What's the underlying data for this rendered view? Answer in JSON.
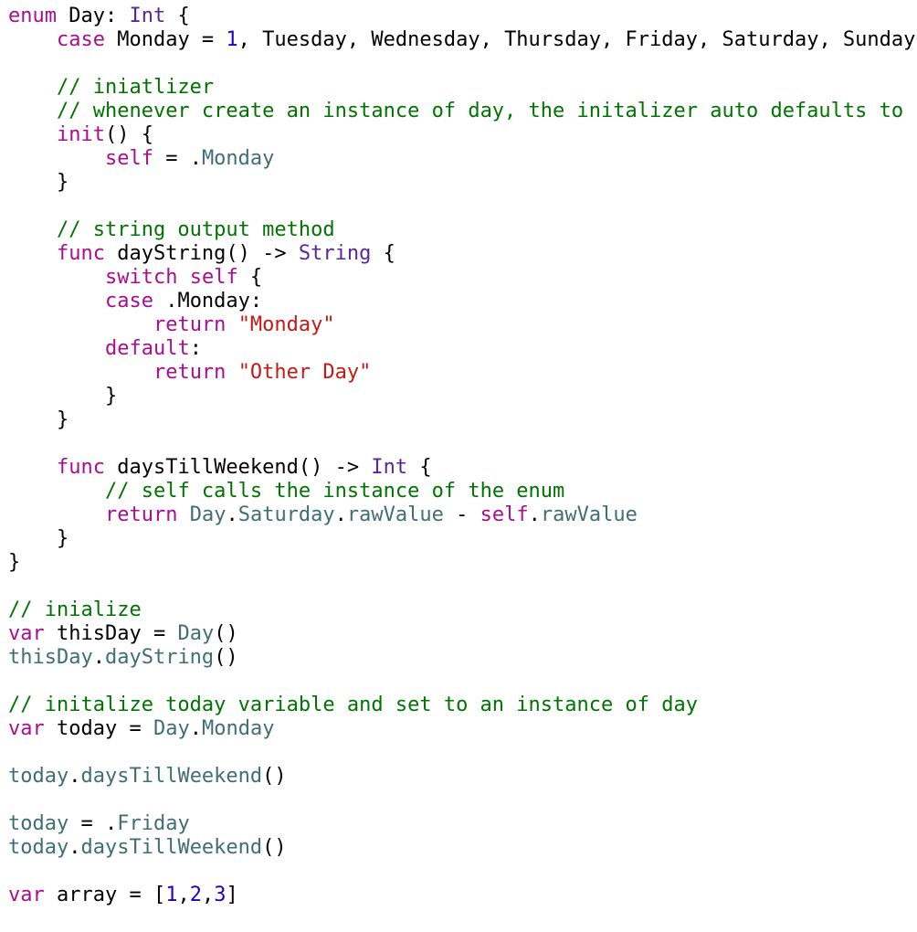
{
  "colors": {
    "keyword": "#aa0d91",
    "type": "#5c2699",
    "comment": "#007400",
    "string": "#c41a16",
    "number": "#1c00cf",
    "project": "#3f6e74",
    "plain": "#000000",
    "background": "#ffffff"
  },
  "lines": [
    [
      [
        "kw",
        "enum"
      ],
      [
        "pl",
        " Day: "
      ],
      [
        "ty",
        "Int"
      ],
      [
        "pl",
        " {"
      ]
    ],
    [
      [
        "pl",
        "    "
      ],
      [
        "kw",
        "case"
      ],
      [
        "pl",
        " Monday = "
      ],
      [
        "nm",
        "1"
      ],
      [
        "pl",
        ", Tuesday, Wednesday, Thursday, Friday, Saturday, Sunday"
      ]
    ],
    [],
    [
      [
        "pl",
        "    "
      ],
      [
        "cm",
        "// iniatlizer"
      ]
    ],
    [
      [
        "pl",
        "    "
      ],
      [
        "cm",
        "// whenever create an instance of day, the initalizer auto defaults to s"
      ]
    ],
    [
      [
        "pl",
        "    "
      ],
      [
        "kw",
        "init"
      ],
      [
        "pl",
        "() {"
      ]
    ],
    [
      [
        "pl",
        "        "
      ],
      [
        "kw",
        "self"
      ],
      [
        "pl",
        " = ."
      ],
      [
        "pj",
        "Monday"
      ]
    ],
    [
      [
        "pl",
        "    }"
      ]
    ],
    [],
    [
      [
        "pl",
        "    "
      ],
      [
        "cm",
        "// string output method"
      ]
    ],
    [
      [
        "pl",
        "    "
      ],
      [
        "kw",
        "func"
      ],
      [
        "pl",
        " dayString() -> "
      ],
      [
        "ty",
        "String"
      ],
      [
        "pl",
        " {"
      ]
    ],
    [
      [
        "pl",
        "        "
      ],
      [
        "kw",
        "switch"
      ],
      [
        "pl",
        " "
      ],
      [
        "kw",
        "self"
      ],
      [
        "pl",
        " {"
      ]
    ],
    [
      [
        "pl",
        "        "
      ],
      [
        "kw",
        "case"
      ],
      [
        "pl",
        " .Monday:"
      ]
    ],
    [
      [
        "pl",
        "            "
      ],
      [
        "kw",
        "return"
      ],
      [
        "pl",
        " "
      ],
      [
        "st",
        "\"Monday\""
      ]
    ],
    [
      [
        "pl",
        "        "
      ],
      [
        "kw",
        "default"
      ],
      [
        "pl",
        ":"
      ]
    ],
    [
      [
        "pl",
        "            "
      ],
      [
        "kw",
        "return"
      ],
      [
        "pl",
        " "
      ],
      [
        "st",
        "\"Other Day\""
      ]
    ],
    [
      [
        "pl",
        "        }"
      ]
    ],
    [
      [
        "pl",
        "    }"
      ]
    ],
    [],
    [
      [
        "pl",
        "    "
      ],
      [
        "kw",
        "func"
      ],
      [
        "pl",
        " daysTillWeekend() -> "
      ],
      [
        "ty",
        "Int"
      ],
      [
        "pl",
        " {"
      ]
    ],
    [
      [
        "pl",
        "        "
      ],
      [
        "cm",
        "// self calls the instance of the enum"
      ]
    ],
    [
      [
        "pl",
        "        "
      ],
      [
        "kw",
        "return"
      ],
      [
        "pl",
        " "
      ],
      [
        "pj",
        "Day"
      ],
      [
        "pl",
        "."
      ],
      [
        "pj",
        "Saturday"
      ],
      [
        "pl",
        "."
      ],
      [
        "pj",
        "rawValue"
      ],
      [
        "pl",
        " - "
      ],
      [
        "kw",
        "self"
      ],
      [
        "pl",
        "."
      ],
      [
        "pj",
        "rawValue"
      ]
    ],
    [
      [
        "pl",
        "    }"
      ]
    ],
    [
      [
        "pl",
        "}"
      ]
    ],
    [],
    [
      [
        "cm",
        "// inialize"
      ]
    ],
    [
      [
        "kw",
        "var"
      ],
      [
        "pl",
        " thisDay = "
      ],
      [
        "pj",
        "Day"
      ],
      [
        "pl",
        "()"
      ]
    ],
    [
      [
        "pj",
        "thisDay"
      ],
      [
        "pl",
        "."
      ],
      [
        "pj",
        "dayString"
      ],
      [
        "pl",
        "()"
      ]
    ],
    [],
    [
      [
        "cm",
        "// initalize today variable and set to an instance of day"
      ]
    ],
    [
      [
        "kw",
        "var"
      ],
      [
        "pl",
        " today = "
      ],
      [
        "pj",
        "Day"
      ],
      [
        "pl",
        "."
      ],
      [
        "pj",
        "Monday"
      ]
    ],
    [],
    [
      [
        "pj",
        "today"
      ],
      [
        "pl",
        "."
      ],
      [
        "pj",
        "daysTillWeekend"
      ],
      [
        "pl",
        "()"
      ]
    ],
    [],
    [
      [
        "pj",
        "today"
      ],
      [
        "pl",
        " = ."
      ],
      [
        "pj",
        "Friday"
      ]
    ],
    [
      [
        "pj",
        "today"
      ],
      [
        "pl",
        "."
      ],
      [
        "pj",
        "daysTillWeekend"
      ],
      [
        "pl",
        "()"
      ]
    ],
    [],
    [
      [
        "kw",
        "var"
      ],
      [
        "pl",
        " array = ["
      ],
      [
        "nm",
        "1"
      ],
      [
        "pl",
        ","
      ],
      [
        "nm",
        "2"
      ],
      [
        "pl",
        ","
      ],
      [
        "nm",
        "3"
      ],
      [
        "pl",
        "]"
      ]
    ]
  ]
}
